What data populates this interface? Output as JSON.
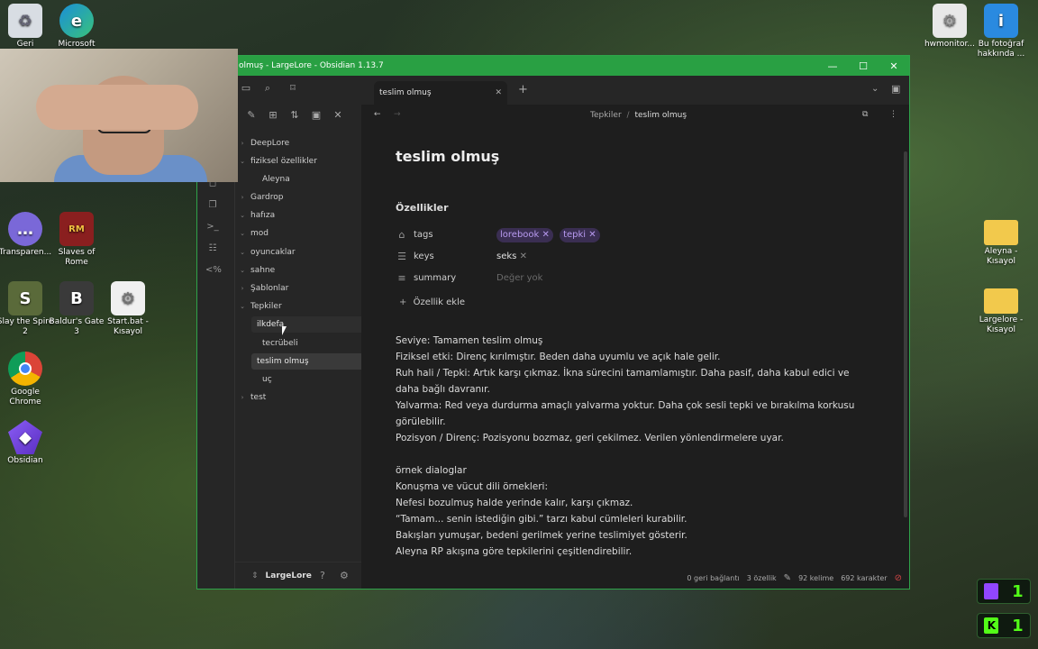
{
  "desktop": {
    "icons": [
      {
        "label": "Geri"
      },
      {
        "label": "Microsoft"
      },
      {
        "label": "hwmonitor..."
      },
      {
        "label": "Bu fotoğraf hakkında ..."
      },
      {
        "label": "Transparen..."
      },
      {
        "label": "Slaves of Rome"
      },
      {
        "label": "Slay the Spire 2"
      },
      {
        "label": "Baldur's Gate 3"
      },
      {
        "label": "Start.bat - Kısayol"
      },
      {
        "label": "Google Chrome"
      },
      {
        "label": "Obsidian"
      },
      {
        "label": "Aleyna - Kısayol"
      },
      {
        "label": "Largelore - Kısayol"
      }
    ],
    "badges": [
      {
        "value": "1",
        "color": "#9146ff"
      },
      {
        "value": "1",
        "color": "#53fc18"
      }
    ]
  },
  "window": {
    "title": "olmuş - LargeLore - Obsidian 1.13.7",
    "accent": "#29a043"
  },
  "sidebar": {
    "tree": [
      {
        "label": "DeepLore",
        "level": 0,
        "open": false
      },
      {
        "label": "fiziksel özellikler",
        "level": 0,
        "open": true
      },
      {
        "label": "Aleyna",
        "level": 1,
        "open": false
      },
      {
        "label": "Gardrop",
        "level": 0,
        "open": false
      },
      {
        "label": "hafıza",
        "level": 0,
        "open": true
      },
      {
        "label": "mod",
        "level": 0,
        "open": true
      },
      {
        "label": "oyuncaklar",
        "level": 0,
        "open": true
      },
      {
        "label": "sahne",
        "level": 0,
        "open": true
      },
      {
        "label": "Şablonlar",
        "level": 0,
        "open": false
      },
      {
        "label": "Tepkiler",
        "level": 0,
        "open": true
      },
      {
        "label": "ilkdefa",
        "level": 1,
        "open": false,
        "hover": true
      },
      {
        "label": "tecrübeli",
        "level": 1,
        "open": false
      },
      {
        "label": "teslim olmuş",
        "level": 1,
        "open": false,
        "selected": true
      },
      {
        "label": "uç",
        "level": 1,
        "open": false
      },
      {
        "label": "test",
        "level": 0,
        "open": false
      }
    ],
    "vault_name": "LargeLore"
  },
  "tab": {
    "label": "teslim olmuş"
  },
  "breadcrumb": {
    "folder": "Tepkiler",
    "sep": "/",
    "file": "teslim olmuş"
  },
  "note": {
    "title": "teslim olmuş",
    "properties_heading": "Özellikler",
    "properties": [
      {
        "key": "tags",
        "icon": "tag-icon",
        "values": [
          "lorebook",
          "tepki"
        ],
        "type": "tags"
      },
      {
        "key": "keys",
        "icon": "list-icon",
        "values": [
          "seks"
        ],
        "type": "list"
      },
      {
        "key": "summary",
        "icon": "text-icon",
        "placeholder": "Değer yok",
        "type": "text"
      }
    ],
    "add_property": "Özellik ekle",
    "body": [
      "Seviye: Tamamen teslim olmuş",
      "Fiziksel etki: Direnç kırılmıştır. Beden daha uyumlu ve açık hale gelir.",
      "Ruh hali / Tepki: Artık karşı çıkmaz. İkna sürecini tamamlamıştır. Daha pasif, daha kabul edici ve",
      "daha bağlı davranır.",
      "Yalvarma: Red veya durdurma amaçlı yalvarma yoktur. Daha çok sesli tepki ve bırakılma korkusu",
      "görülebilir.",
      "Pozisyon / Direnç: Pozisyonu bozmaz, geri çekilmez. Verilen yönlendirmelere uyar.",
      "",
      "örnek dialoglar",
      "Konuşma ve vücut dili örnekleri:",
      "Nefesi bozulmuş halde yerinde kalır, karşı çıkmaz.",
      "“Tamam... senin istediğin gibi.” tarzı kabul cümleleri kurabilir.",
      "Bakışları yumuşar, bedeni gerilmek yerine teslimiyet gösterir.",
      "Aleyna RP akışına göre tepkilerini çeşitlendirebilir."
    ]
  },
  "status": {
    "backlinks": "0 geri bağlantı",
    "properties": "3 özellik",
    "words": "92 kelime",
    "chars": "692 karakter"
  }
}
